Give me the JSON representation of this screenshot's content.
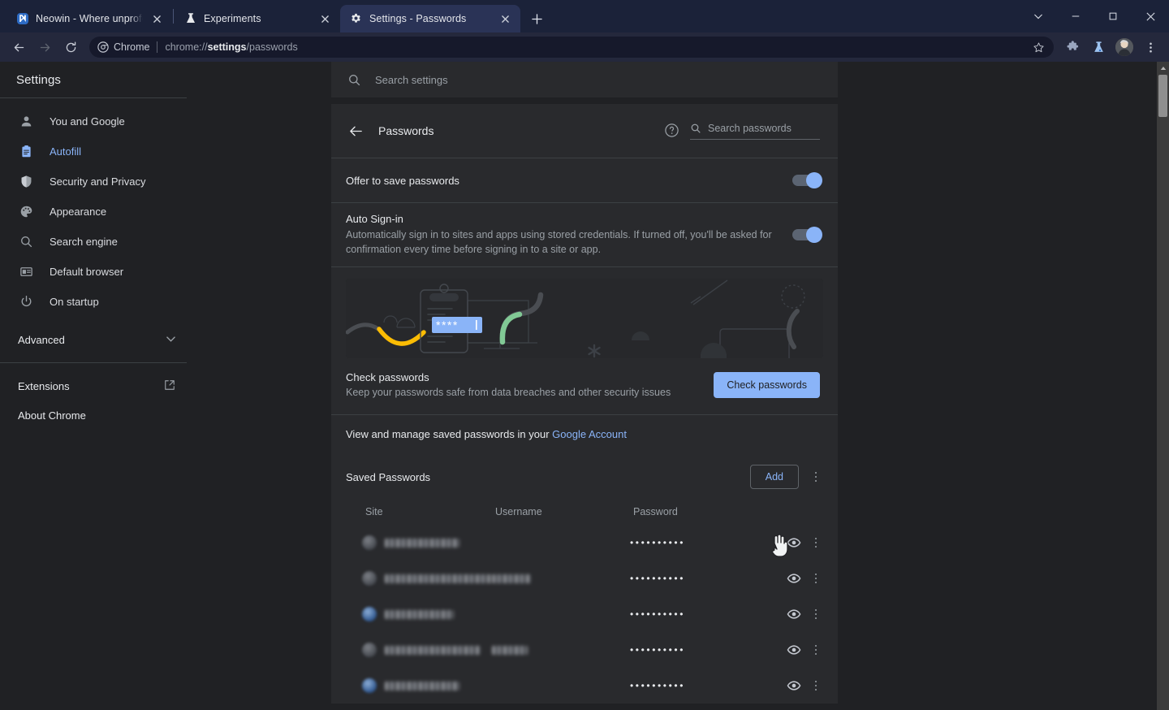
{
  "window": {
    "controls": [
      {
        "name": "chevron-down-icon",
        "glyph": "∨"
      },
      {
        "name": "minimize-button",
        "glyph": "–"
      },
      {
        "name": "maximize-button",
        "glyph": "□"
      },
      {
        "name": "close-button",
        "glyph": "✕"
      }
    ]
  },
  "tabs": [
    {
      "title": "Neowin - Where unprofessional",
      "favicon": "neowin-favicon",
      "active": false
    },
    {
      "title": "Experiments",
      "favicon": "flask-icon",
      "active": false
    },
    {
      "title": "Settings - Passwords",
      "favicon": "gear-icon",
      "active": true
    }
  ],
  "new_tab_label": "+",
  "toolbar": {
    "back_label": "←",
    "forward_label": "→",
    "reload_label": "⟳",
    "omnibox": {
      "chip_label": "Chrome",
      "url_prefix": "chrome://",
      "url_bold": "settings",
      "url_suffix": "/passwords",
      "star_icon": "bookmark-star-icon"
    },
    "extensions_icon": "puzzle-piece-icon",
    "experiments_icon": "flask-icon",
    "avatar_icon": "profile-avatar",
    "menu_icon": "three-dot-menu-icon"
  },
  "sidebar": {
    "title": "Settings",
    "items": [
      {
        "label": "You and Google",
        "icon": "person-icon",
        "selected": false
      },
      {
        "label": "Autofill",
        "icon": "clipboard-icon",
        "selected": true
      },
      {
        "label": "Security and Privacy",
        "icon": "shield-icon",
        "selected": false
      },
      {
        "label": "Appearance",
        "icon": "palette-icon",
        "selected": false
      },
      {
        "label": "Search engine",
        "icon": "search-icon",
        "selected": false
      },
      {
        "label": "Default browser",
        "icon": "browser-window-icon",
        "selected": false
      },
      {
        "label": "On startup",
        "icon": "power-icon",
        "selected": false
      }
    ],
    "advanced_label": "Advanced",
    "extensions_label": "Extensions",
    "about_label": "About Chrome"
  },
  "search_settings": {
    "placeholder": "Search settings",
    "value": ""
  },
  "passwords_page": {
    "title": "Passwords",
    "search_placeholder": "Search passwords",
    "search_value": "",
    "offer_to_save": {
      "label": "Offer to save passwords",
      "state": "on"
    },
    "auto_signin": {
      "label": "Auto Sign-in",
      "description": "Automatically sign in to sites and apps using stored credentials. If turned off, you'll be asked for confirmation every time before signing in to a site or app.",
      "state": "on"
    },
    "check_passwords": {
      "title": "Check passwords",
      "subtitle": "Keep your passwords safe from data breaches and other security issues",
      "button_label": "Check passwords"
    },
    "google_account_line": {
      "text": "View and manage saved passwords in your",
      "link": "Google Account"
    },
    "saved_passwords": {
      "title": "Saved Passwords",
      "add_label": "Add",
      "columns": [
        "Site",
        "Username",
        "Password"
      ],
      "rows": [
        {
          "site": "redacted",
          "username": "",
          "password": "••••••••••",
          "favicon": "grey",
          "site_w": 92,
          "user_w": 0
        },
        {
          "site": "redacted",
          "username": "redacted",
          "password": "••••••••••",
          "favicon": "grey",
          "site_w": 131,
          "user_w": 48
        },
        {
          "site": "redacted",
          "username": "",
          "password": "••••••••••",
          "favicon": "blue",
          "site_w": 85,
          "user_w": 0
        },
        {
          "site": "redacted",
          "username": "redacted",
          "password": "••••••••••",
          "favicon": "grey",
          "site_w": 118,
          "user_w": 44
        },
        {
          "site": "redacted",
          "username": "",
          "password": "••••••••••",
          "favicon": "blue",
          "site_w": 92,
          "user_w": 0
        }
      ],
      "row_eye_icon": "eye-icon",
      "row_menu_icon": "three-dot-menu-icon"
    }
  },
  "colors": {
    "accent_blue": "#8ab4f8",
    "page_bg": "#202124",
    "card_bg": "#292a2d",
    "tabstrip_bg": "#1b2239",
    "active_tab_bg": "#2a3356",
    "divider": "#3c4043",
    "text_primary": "#e8eaed",
    "text_secondary": "#9aa0a6",
    "illustration_yellow": "#fbbc04",
    "illustration_green": "#81c995"
  }
}
